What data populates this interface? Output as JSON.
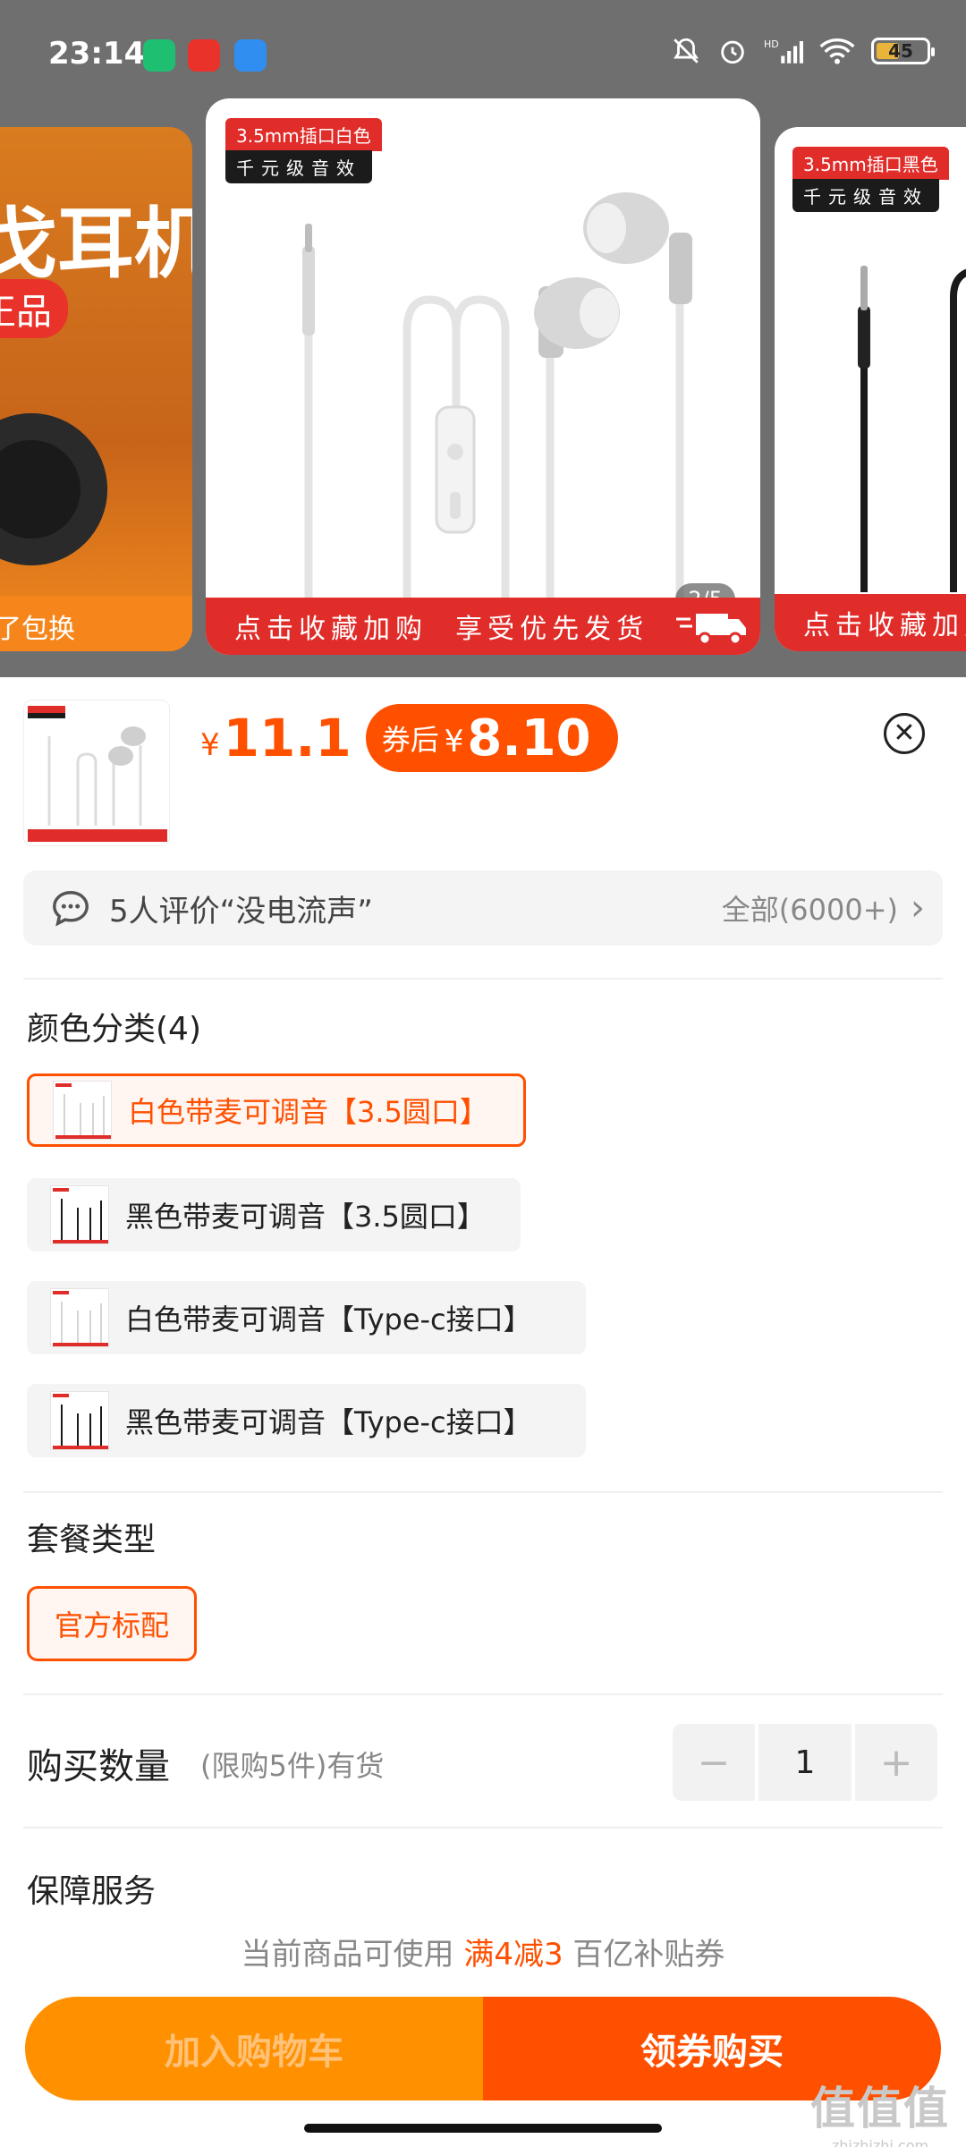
{
  "status_bar": {
    "time": "23:14",
    "battery": "45",
    "icons": [
      "mute-bell-icon",
      "alarm-icon",
      "hd-signal-icon",
      "wifi-icon",
      "battery-icon"
    ]
  },
  "carousel": {
    "left_card": {
      "headline": "戈耳机",
      "tag": "正品",
      "footer": "了包换"
    },
    "center_card": {
      "badge_top": "3.5mm插口白色",
      "badge_bottom": "千元级音效",
      "footer": "点击收藏加购  享受优先发货",
      "pager": "2/5"
    },
    "right_card": {
      "badge_top": "3.5mm插口黑色",
      "badge_bottom": "千元级音效",
      "footer": "点击收藏加购"
    }
  },
  "product": {
    "currency": "¥",
    "price": "11.1",
    "coupon_label": "券后",
    "coupon_price": "8.10"
  },
  "review_bar": {
    "text": "5人评价“没电流声”",
    "all_label": "全部(6000+)"
  },
  "color_section": {
    "title": "颜色分类(4)",
    "options": [
      {
        "label": "白色带麦可调音【3.5圆口】",
        "selected": true
      },
      {
        "label": "黑色带麦可调音【3.5圆口】",
        "selected": false
      },
      {
        "label": "白色带麦可调音【Type-c接口】",
        "selected": false
      },
      {
        "label": "黑色带麦可调音【Type-c接口】",
        "selected": false
      }
    ]
  },
  "package_section": {
    "title": "套餐类型",
    "option": "官方标配"
  },
  "quantity": {
    "label": "购买数量",
    "limit": "(限购5件)有货",
    "value": "1",
    "minus": "−",
    "plus": "+"
  },
  "guarantee": {
    "title": "保障服务"
  },
  "coupon_note": {
    "prefix": "当前商品可使用 ",
    "highlight": "满4减3",
    "suffix": " 百亿补贴券"
  },
  "actions": {
    "add_to_cart": "加入购物车",
    "buy": "领券购买"
  },
  "watermark": {
    "main": "值值值",
    "sub": "zhizhizhi.com"
  },
  "colors": {
    "accent": "#ff5000",
    "cart": "#ff9000",
    "badge_red": "#e02d2a"
  }
}
